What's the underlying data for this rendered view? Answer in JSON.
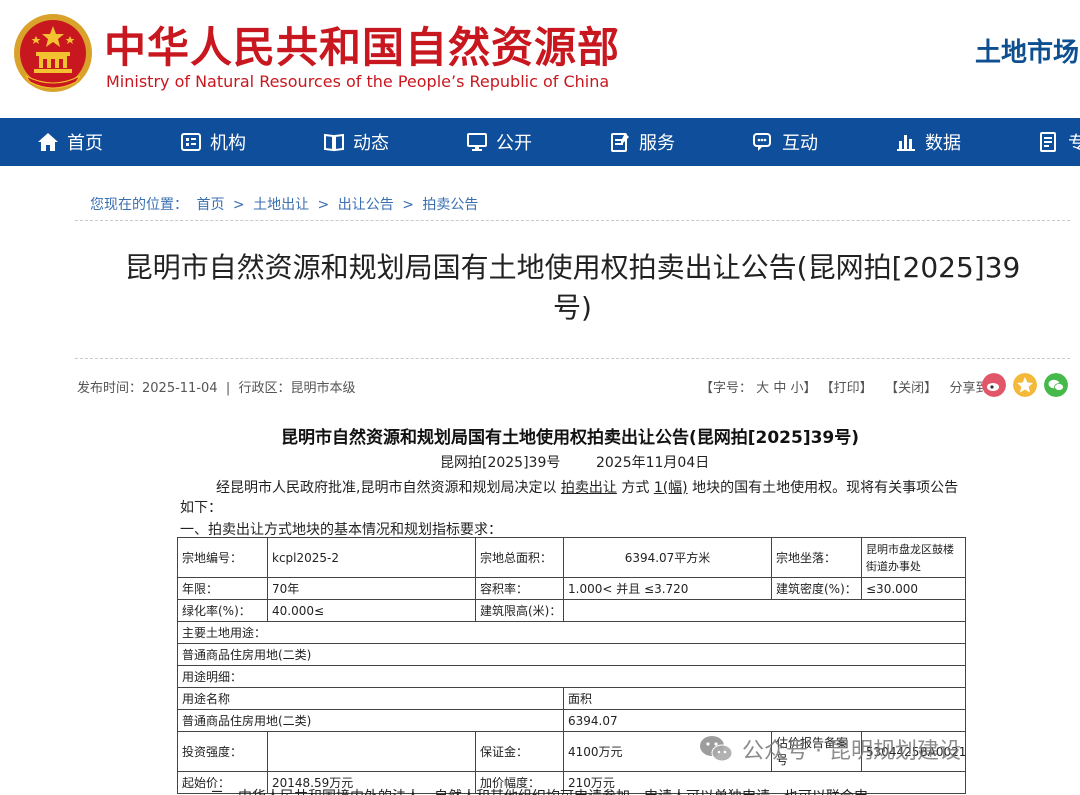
{
  "header": {
    "ministry_cn": "中华人民共和国自然资源部",
    "ministry_en": "Ministry of Natural Resources of the People’s Republic of China",
    "right_title": "土地市场"
  },
  "nav": {
    "items": [
      {
        "label": "首页",
        "icon": "home-icon"
      },
      {
        "label": "机构",
        "icon": "org-icon"
      },
      {
        "label": "动态",
        "icon": "book-icon"
      },
      {
        "label": "公开",
        "icon": "monitor-icon"
      },
      {
        "label": "服务",
        "icon": "clipboard-icon"
      },
      {
        "label": "互动",
        "icon": "chat-icon"
      },
      {
        "label": "数据",
        "icon": "bar-chart-icon"
      },
      {
        "label": "专",
        "icon": "document-icon"
      }
    ]
  },
  "breadcrumb": {
    "prefix": "您现在的位置：",
    "items": [
      "首页",
      "土地出让",
      "出让公告",
      "拍卖公告"
    ],
    "separator": ">"
  },
  "page": {
    "title_line1": "昆明市自然资源和规划局国有土地使用权拍卖出让公告(昆网拍[2025]39",
    "title_line2": "号)"
  },
  "meta": {
    "publish_label": "发布时间：",
    "publish_date": "2025-11-04",
    "region_label": "行政区：",
    "region": "昆明市本级",
    "font_size_label": "【字号：",
    "size_large": "大",
    "size_medium": "中",
    "size_small": "小】",
    "print": "【打印】",
    "close": "【关闭】",
    "share_label": "分享到："
  },
  "article": {
    "title": "昆明市自然资源和规划局国有土地使用权拍卖出让公告(昆网拍[2025]39号)",
    "number": "昆网拍[2025]39号",
    "date": "2025年11月04日",
    "para_a": "经昆明市人民政府批准,昆明市自然资源和规划局决定以 ",
    "para_method": "拍卖出让",
    "para_b": " 方式 ",
    "para_count": "1(幅)",
    "para_c": " 地块的国有土地使用权。现将有关事项公告如下：",
    "section1": "一、拍卖出让方式地块的基本情况和规划指标要求："
  },
  "table": {
    "parcel_no_label": "宗地编号：",
    "parcel_no": "kcpl2025-2",
    "area_label": "宗地总面积：",
    "area": "6394.07平方米",
    "location_label": "宗地坐落：",
    "location": "昆明市盘龙区鼓楼街道办事处",
    "term_label": "年限：",
    "term": "70年",
    "far_label": "容积率：",
    "far": "1.000< 并且 ≤3.720",
    "density_label": "建筑密度(%)：",
    "density": "≤30.000",
    "green_label": "绿化率(%)：",
    "green": "40.000≤",
    "height_label": "建筑限高(米)：",
    "height": "",
    "main_use_label": "主要土地用途：",
    "main_use": "普通商品住房用地(二类)",
    "use_detail_label": "用途明细：",
    "use_name_header": "用途名称",
    "use_area_header": "面积",
    "use_name": "普通商品住房用地(二类)",
    "use_area": "6394.07",
    "invest_label": "投资强度：",
    "invest": "",
    "deposit_label": "保证金：",
    "deposit": "4100万元",
    "appraisal_label": "估价报告备案号",
    "appraisal_no": "5304425BA0021",
    "start_price_label": "起始价：",
    "start_price": "20148.59万元",
    "increment_label": "加价幅度：",
    "increment": "210万元"
  },
  "watermark": {
    "text": "公众号 · 昆明规划建设"
  },
  "bottom_cut": "二、中华人民共和国境内外的法人、自然人和其他组织均可申请参加，申请人可以单独申请，也可以联合申"
}
